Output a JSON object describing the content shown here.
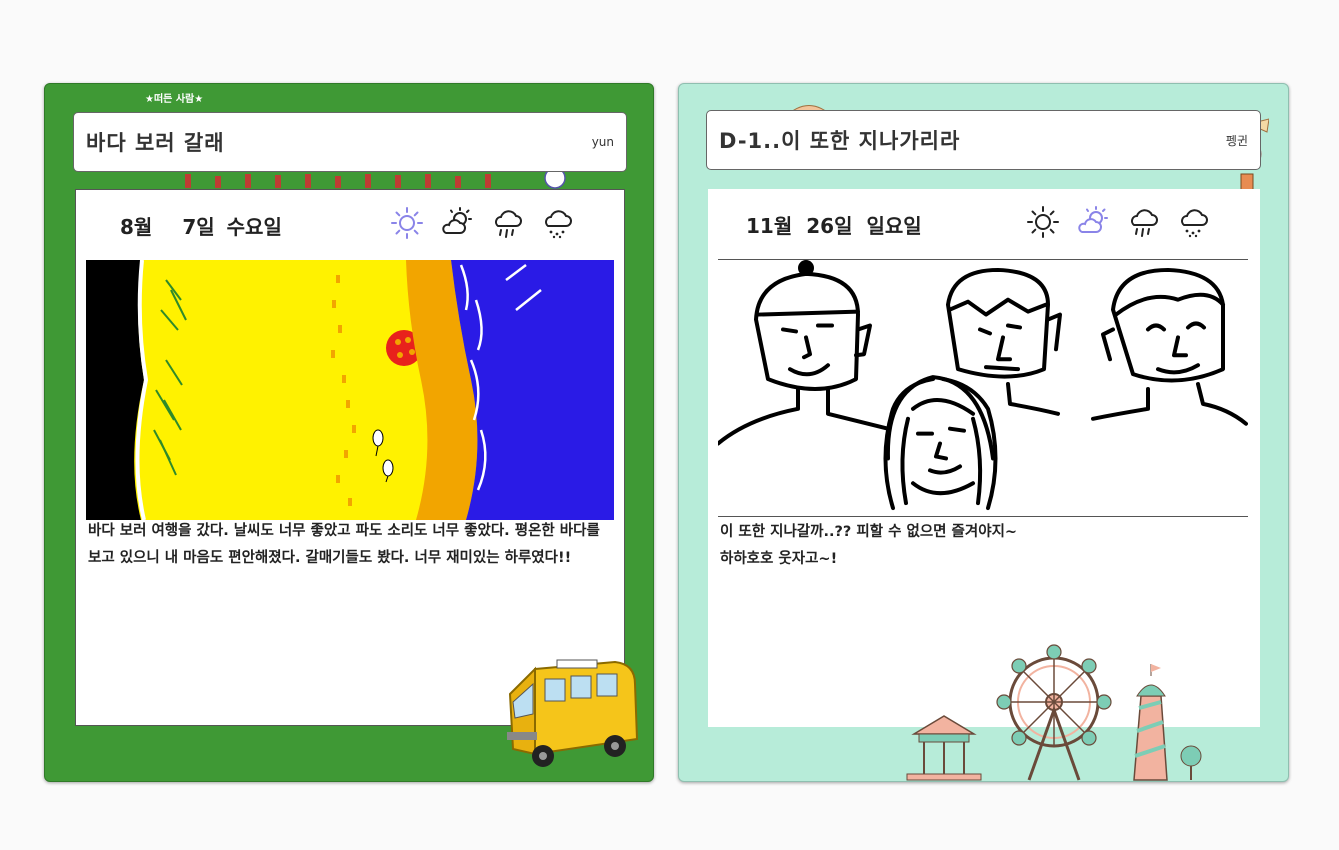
{
  "cards": [
    {
      "group_label": "★떠든 사람★",
      "title": "바다 보러 갈래",
      "author": "yun",
      "date": {
        "month": "8월",
        "day": "7일",
        "weekday": "수요일"
      },
      "weather": {
        "selected": "sunny",
        "icons": [
          "sunny-icon",
          "partly-cloudy-icon",
          "rain-icon",
          "snow-icon"
        ]
      },
      "body": "바다 보러 여행을 갔다. 날씨도 너무 좋았고 파도 소리도 너무 좋았다. 평온한 바다를 보고 있으니 내 마음도 편안해졌다. 갈매기들도 봤다. 너무 재미있는 하루였다!!"
    },
    {
      "title": "D-1..이 또한 지나가리라",
      "author": "펭귄",
      "date": {
        "month": "11월",
        "day": "26일",
        "weekday": "일요일"
      },
      "weather": {
        "selected": "partly-cloudy",
        "icons": [
          "sunny-icon",
          "partly-cloudy-icon",
          "rain-icon",
          "snow-icon"
        ]
      },
      "body_lines": [
        "이 또한 지나갈까..?? 피할 수 없으면 즐겨야지~",
        "하하호호 웃자고~!"
      ]
    }
  ],
  "colors": {
    "card1_bg": "#3f9935",
    "card2_bg": "#b7ecd9",
    "selected_weather": "#8a84e8",
    "ocean": "#2a1be6",
    "sand": "#fff200",
    "wet_sand": "#f2a500"
  }
}
